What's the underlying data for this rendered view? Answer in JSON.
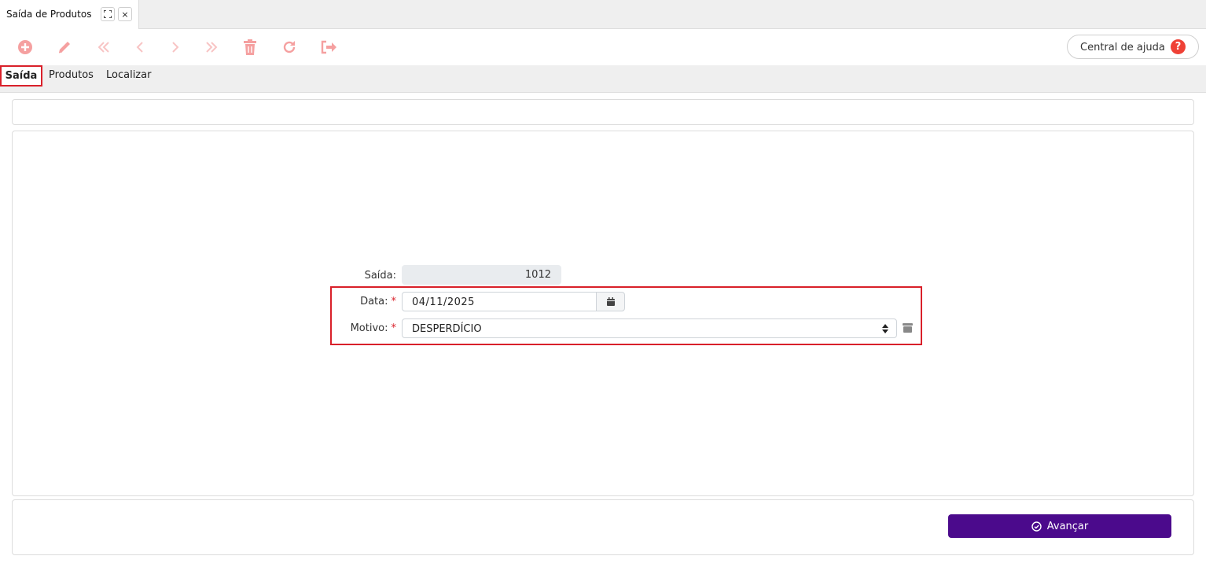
{
  "doc_tab": {
    "title": "Saída de Produtos",
    "expand_icon": "expand-icon",
    "close_label": "×"
  },
  "toolbar": {
    "icons": [
      "add-icon",
      "edit-icon",
      "first-icon",
      "previous-icon",
      "next-icon",
      "last-icon",
      "delete-icon",
      "refresh-icon",
      "exit-icon"
    ],
    "icon_color": "#f5a0a0",
    "help_label": "Central de ajuda",
    "help_q": "?"
  },
  "section_tabs": [
    {
      "label": "Saída",
      "active": true
    },
    {
      "label": "Produtos",
      "active": false
    },
    {
      "label": "Localizar",
      "active": false
    }
  ],
  "form": {
    "saida_label": "Saída:",
    "saida_value": "1012",
    "data_label": "Data:",
    "data_value": "04/11/2025",
    "motivo_label": "Motivo:",
    "motivo_value": "DESPERDÍCIO",
    "required_mark": "*"
  },
  "footer": {
    "avancar_label": "Avançar",
    "button_color": "#4b0a8c"
  }
}
